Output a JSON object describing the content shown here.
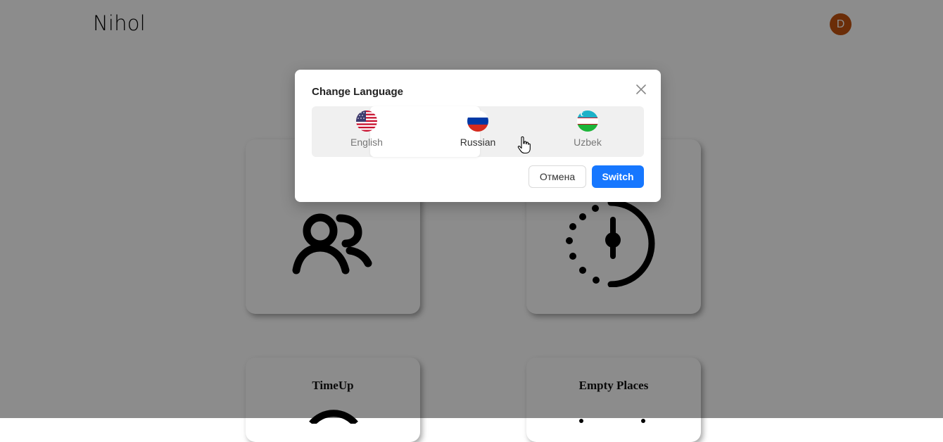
{
  "header": {
    "brand": "Nihol",
    "avatar_letter": "D"
  },
  "cards": [
    {
      "title": "",
      "icon": "users-icon"
    },
    {
      "title": "",
      "icon": "clock-half-dotted-icon"
    },
    {
      "title": "TimeUp",
      "icon": "rss-feed-icon"
    },
    {
      "title": "Empty Places",
      "icon": "place-icon"
    }
  ],
  "modal": {
    "title": "Change Language",
    "languages": [
      {
        "label": "English",
        "flag": "us-flag-icon"
      },
      {
        "label": "Russian",
        "flag": "russia-flag-icon"
      },
      {
        "label": "Uzbek",
        "flag": "uzbekistan-flag-icon"
      }
    ],
    "selected_language": "Russian",
    "cancel_label": "Отмена",
    "confirm_label": "Switch"
  },
  "colors": {
    "primary": "#1677ff",
    "avatar": "#c4520f",
    "overlay": "rgba(0,0,0,0.45)"
  }
}
